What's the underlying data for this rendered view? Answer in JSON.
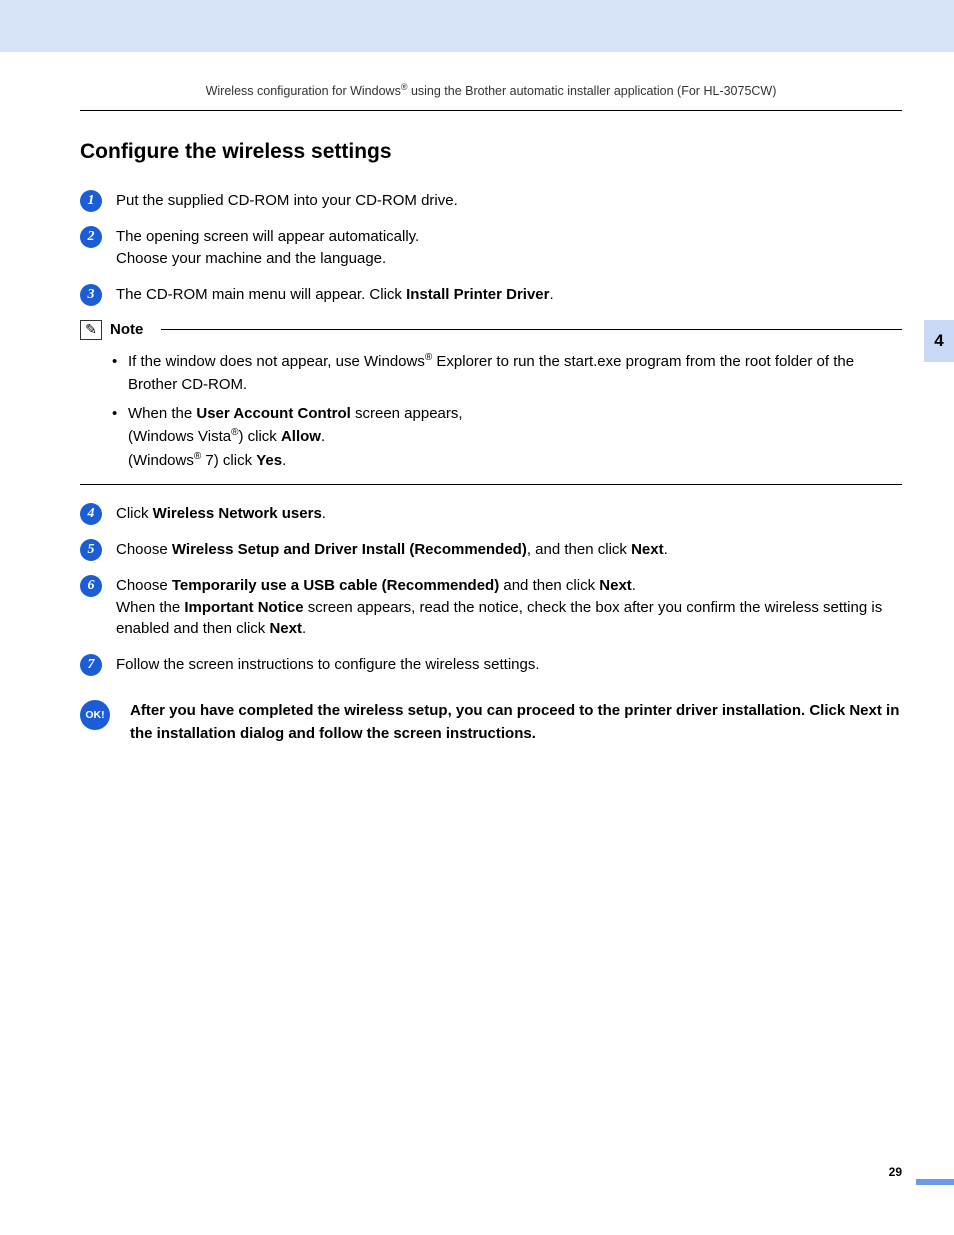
{
  "header": {
    "pre": "Wireless configuration for Windows",
    "sup": "®",
    "post": " using the Brother automatic installer application (For HL-3075CW)"
  },
  "chapter_tab": "4",
  "section_title": "Configure the wireless settings",
  "steps": {
    "s1": {
      "num": "1",
      "text": "Put the supplied CD-ROM into your CD-ROM drive."
    },
    "s2": {
      "num": "2",
      "line1": "The opening screen will appear automatically.",
      "line2": "Choose your machine and the language."
    },
    "s3": {
      "num": "3",
      "pre": "The CD-ROM main menu will appear. Click ",
      "bold": "Install Printer Driver",
      "post": "."
    }
  },
  "note": {
    "label": "Note",
    "item1": {
      "pre": "If the window does not appear, use Windows",
      "sup": "®",
      "post": " Explorer to run the start.exe program from the root folder of the Brother CD-ROM."
    },
    "item2": {
      "line1_pre": "When the ",
      "line1_bold": "User Account Control",
      "line1_post": " screen appears,",
      "line2_pre": "(Windows Vista",
      "line2_sup": "®",
      "line2_mid": ") click ",
      "line2_bold": "Allow",
      "line2_post": ".",
      "line3_pre": "(Windows",
      "line3_sup": "®",
      "line3_mid": " 7) click ",
      "line3_bold": "Yes",
      "line3_post": "."
    }
  },
  "steps2": {
    "s4": {
      "num": "4",
      "pre": "Click ",
      "bold": "Wireless Network users",
      "post": "."
    },
    "s5": {
      "num": "5",
      "pre": "Choose ",
      "bold": "Wireless Setup and Driver Install (Recommended)",
      "mid": ", and then click ",
      "bold2": "Next",
      "post": "."
    },
    "s6": {
      "num": "6",
      "l1_pre": "Choose ",
      "l1_bold": "Temporarily use a USB cable (Recommended)",
      "l1_mid": " and then click ",
      "l1_bold2": "Next",
      "l1_post": ".",
      "l2_pre": "When the ",
      "l2_bold": "Important Notice",
      "l2_mid": " screen appears, read the notice, check the box after you confirm the wireless setting is enabled and then click ",
      "l2_bold2": "Next",
      "l2_post": "."
    },
    "s7": {
      "num": "7",
      "text": "Follow the screen instructions to configure the wireless settings."
    }
  },
  "ok": {
    "badge": "OK!",
    "text": "After you have completed the wireless setup, you can proceed to the printer driver installation. Click Next in the installation dialog and follow the screen instructions."
  },
  "page_number": "29"
}
